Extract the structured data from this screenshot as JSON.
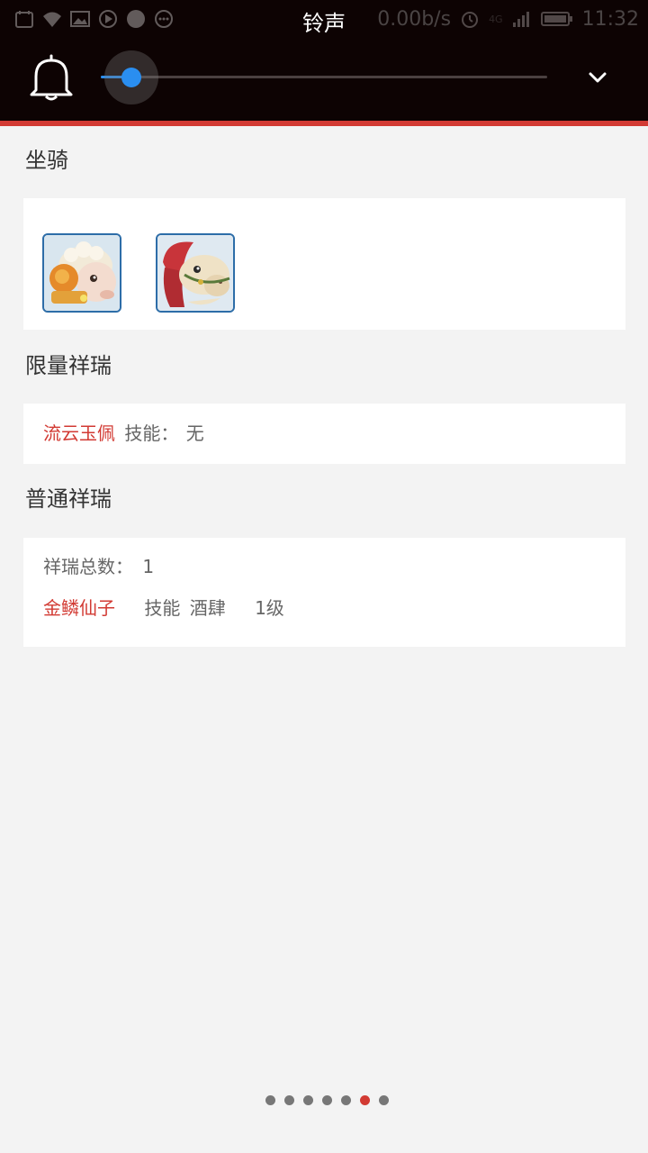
{
  "status_bar": {
    "title": "铃声",
    "net_speed": "0.00b/s",
    "network": "4G",
    "time": "11:32",
    "icons": [
      "calendar-icon",
      "wifi-icon",
      "image-icon",
      "play-icon",
      "dot-icon",
      "chat-icon",
      "alarm-icon",
      "signal-icon",
      "battery-icon"
    ]
  },
  "volume_panel": {
    "icon": "bell-icon",
    "level": 0.06,
    "expand_icon": "chevron-down-icon"
  },
  "sections": {
    "mounts": {
      "title": "坐骑",
      "items": [
        "sheep-mount-icon",
        "horse-mount-icon"
      ]
    },
    "limited": {
      "title": "限量祥瑞",
      "name": "流云玉佩",
      "skill_label": "技能：",
      "skill_value": "无"
    },
    "normal": {
      "title": "普通祥瑞",
      "total_label": "祥瑞总数：",
      "total_value": "1",
      "name": "金鳞仙子",
      "skill_label": "技能",
      "skill_value": "酒肆",
      "level": "1级"
    }
  },
  "pager": {
    "count": 7,
    "active_index": 5
  },
  "colors": {
    "accent": "#d23a33",
    "slider": "#2a8ef0",
    "header_bg": "#0d0303"
  }
}
